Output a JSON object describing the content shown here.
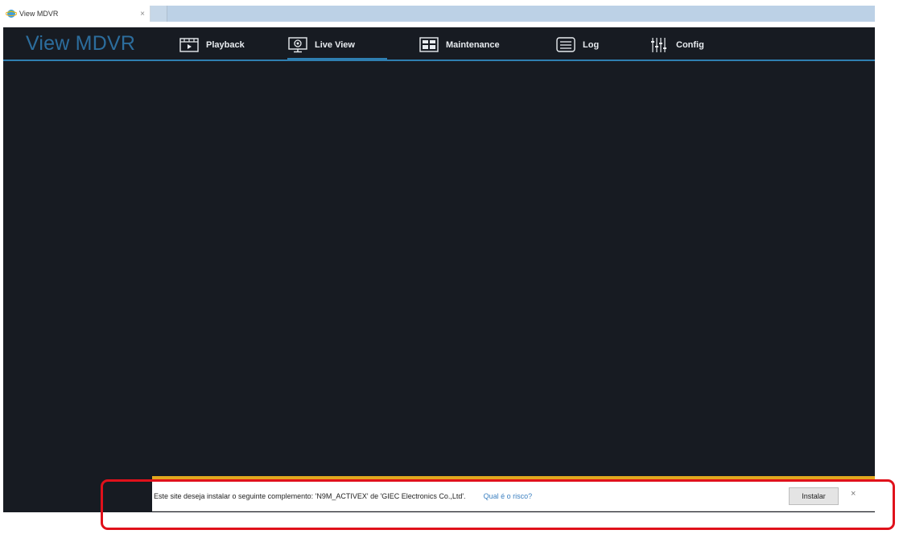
{
  "browser": {
    "tab_title": "View MDVR",
    "tab_close": "×",
    "ie_icon": "ie-globe-icon"
  },
  "app": {
    "brand": "View MDVR",
    "accent_color": "#2f7fb1",
    "nav": [
      {
        "label": "Playback",
        "icon": "playback-icon"
      },
      {
        "label": "Live View",
        "icon": "monitor-icon",
        "active": true
      },
      {
        "label": "Maintenance",
        "icon": "maintenance-icon"
      },
      {
        "label": "Log",
        "icon": "log-icon"
      },
      {
        "label": "Config",
        "icon": "sliders-icon"
      }
    ]
  },
  "infobar": {
    "message": "Este site deseja instalar o seguinte complemento: 'N9M_ACTIVEX' de 'GIEC Electronics Co.,Ltd'.",
    "risk_link": "Qual é o risco?",
    "install_label": "Instalar",
    "close_label": "×",
    "accent_color": "#e3a81e"
  },
  "annotation": {
    "highlight_color": "#e0111b"
  }
}
